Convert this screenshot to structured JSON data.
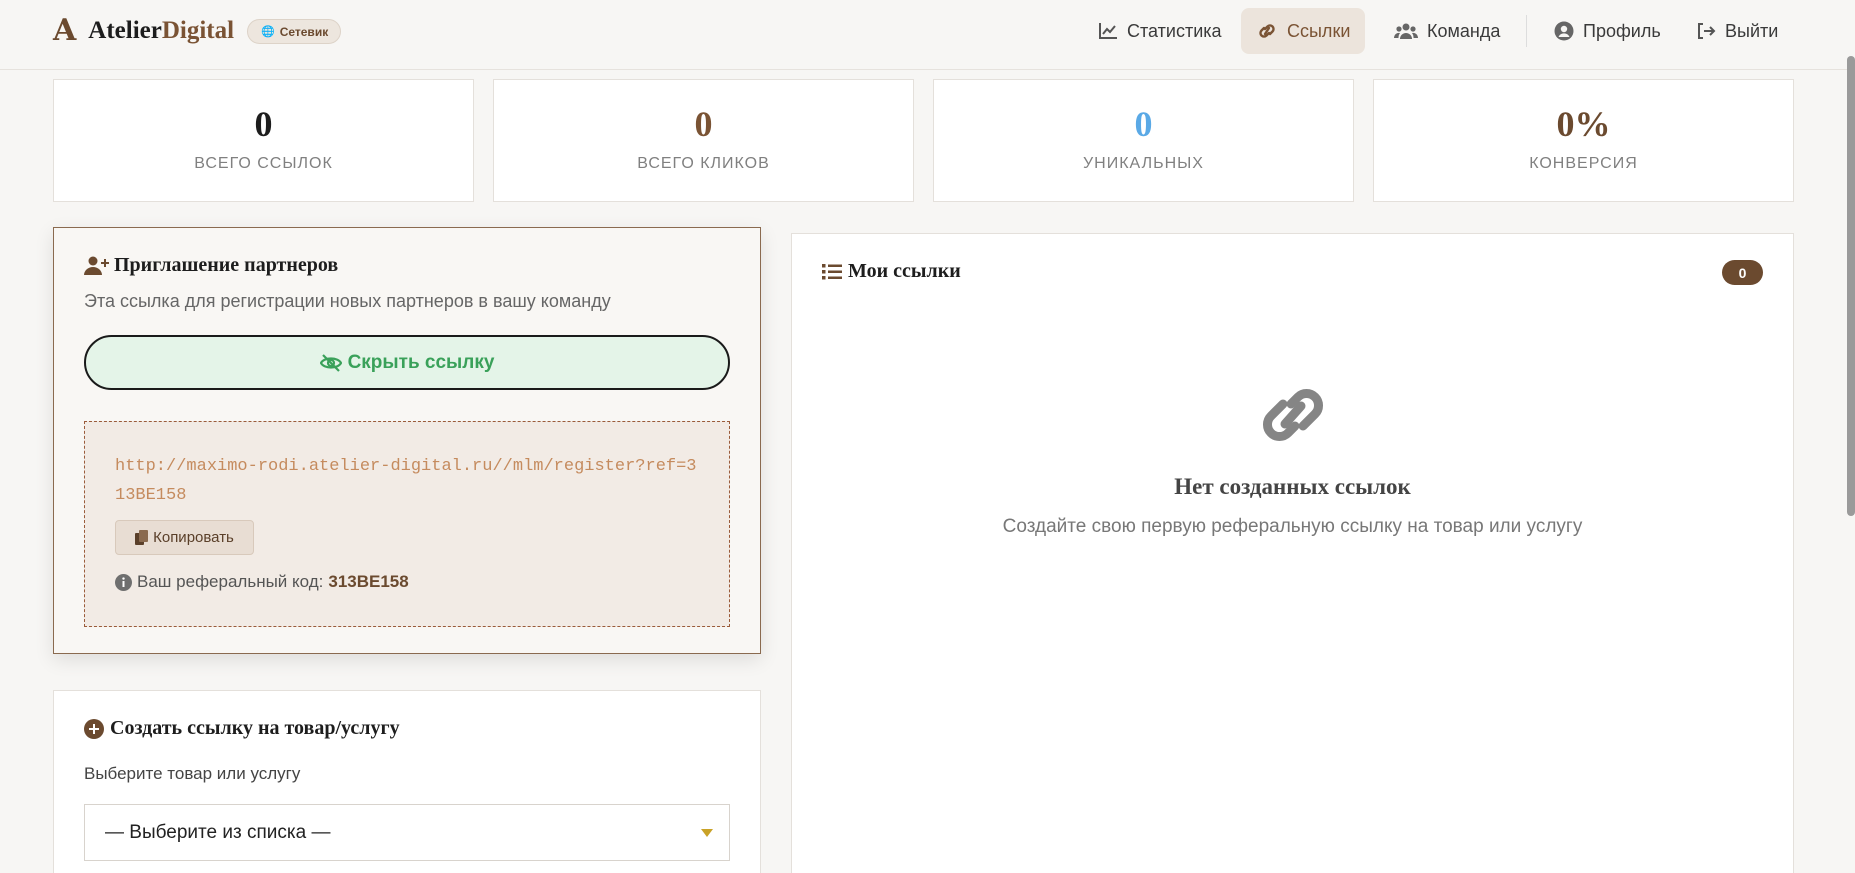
{
  "header": {
    "logo_mark": "A",
    "logo_word1": "Atelier",
    "logo_word2": "Digital",
    "role_badge": "Сетевик",
    "nav": [
      {
        "label": "Статистика",
        "icon": "chart-line-icon"
      },
      {
        "label": "Ссылки",
        "icon": "link-icon",
        "active": true
      },
      {
        "label": "Команда",
        "icon": "users-icon"
      },
      {
        "label": "Профиль",
        "icon": "user-circle-icon"
      },
      {
        "label": "Выйти",
        "icon": "logout-icon"
      }
    ]
  },
  "stats": [
    {
      "value": "0",
      "label": "ВСЕГО ССЫЛОК",
      "color": "#1d1d1d"
    },
    {
      "value": "0",
      "label": "ВСЕГО КЛИКОВ",
      "color": "#7a5334"
    },
    {
      "value": "0",
      "label": "УНИКАЛЬНЫХ",
      "color": "#5aa9e6"
    },
    {
      "value": "0%",
      "label": "КОНВЕРСИЯ",
      "color": "#6b4a2f"
    }
  ],
  "invite": {
    "title": "Приглашение партнеров",
    "description": "Эта ссылка для регистрации новых партнеров в вашу команду",
    "hide_button": "Скрыть ссылку",
    "url": "http://maximo-rodi.atelier-digital.ru//mlm/register?ref=313BE158",
    "copy_button": "Копировать",
    "ref_label": "Ваш реферальный код:",
    "ref_code": "313BE158"
  },
  "create": {
    "title": "Создать ссылку на товар/услугу",
    "select_label": "Выберите товар или услугу",
    "select_value": "— Выберите из списка —"
  },
  "my_links": {
    "title": "Мои ссылки",
    "count": "0",
    "empty_title": "Нет созданных ссылок",
    "empty_subtitle": "Создайте свою первую реферальную ссылку на товар или услугу"
  },
  "colors": {
    "brand": "#6b4a2f",
    "accent_green": "#3aa15a",
    "background": "#f7f6f4"
  }
}
